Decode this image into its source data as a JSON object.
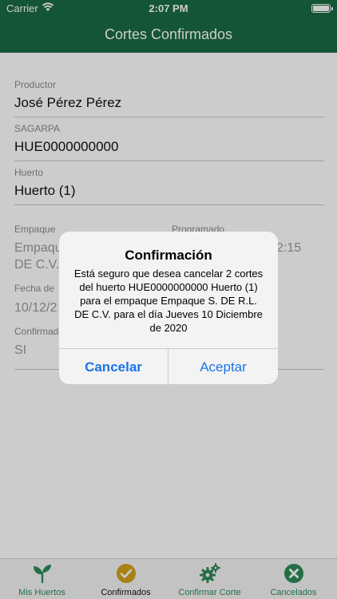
{
  "status": {
    "carrier": "Carrier",
    "time": "2:07 PM"
  },
  "nav": {
    "title": "Cortes Confirmados"
  },
  "fields": {
    "productor_label": "Productor",
    "productor_value": "José Pérez Pérez",
    "sagarpa_label": "SAGARPA",
    "sagarpa_value": "HUE0000000000",
    "huerto_label": "Huerto",
    "huerto_value": "Huerto (1)",
    "empaque_label": "Empaque",
    "programado_label": "Programado",
    "empaque_value_1": "Empaque",
    "empaque_value_2": "DE C.V.",
    "programado_value_partial": "2:15",
    "fecha_label": "Fecha de",
    "fecha_value": "10/12/2",
    "confirmado_label": "Confirmado",
    "confirmado_value": "SI"
  },
  "alert": {
    "title": "Confirmación",
    "message": "Está seguro que desea cancelar 2 cortes del huerto HUE0000000000 Huerto (1) para el empaque Empaque S. DE R.L. DE C.V. para el día Jueves 10 Diciembre de 2020",
    "cancel_label": "Cancelar",
    "accept_label": "Aceptar"
  },
  "tabs": [
    {
      "label": "Mis Huertos",
      "icon": "sprout-icon"
    },
    {
      "label": "Confirmados",
      "icon": "check-circle-icon",
      "active": true
    },
    {
      "label": "Confirmar Corte",
      "icon": "gears-icon"
    },
    {
      "label": "Cancelados",
      "icon": "x-circle-icon"
    }
  ],
  "colors": {
    "primary": "#1a6b43",
    "tint": "#2e8a57",
    "active_check": "#d4a21a",
    "link": "#1a73e8"
  }
}
